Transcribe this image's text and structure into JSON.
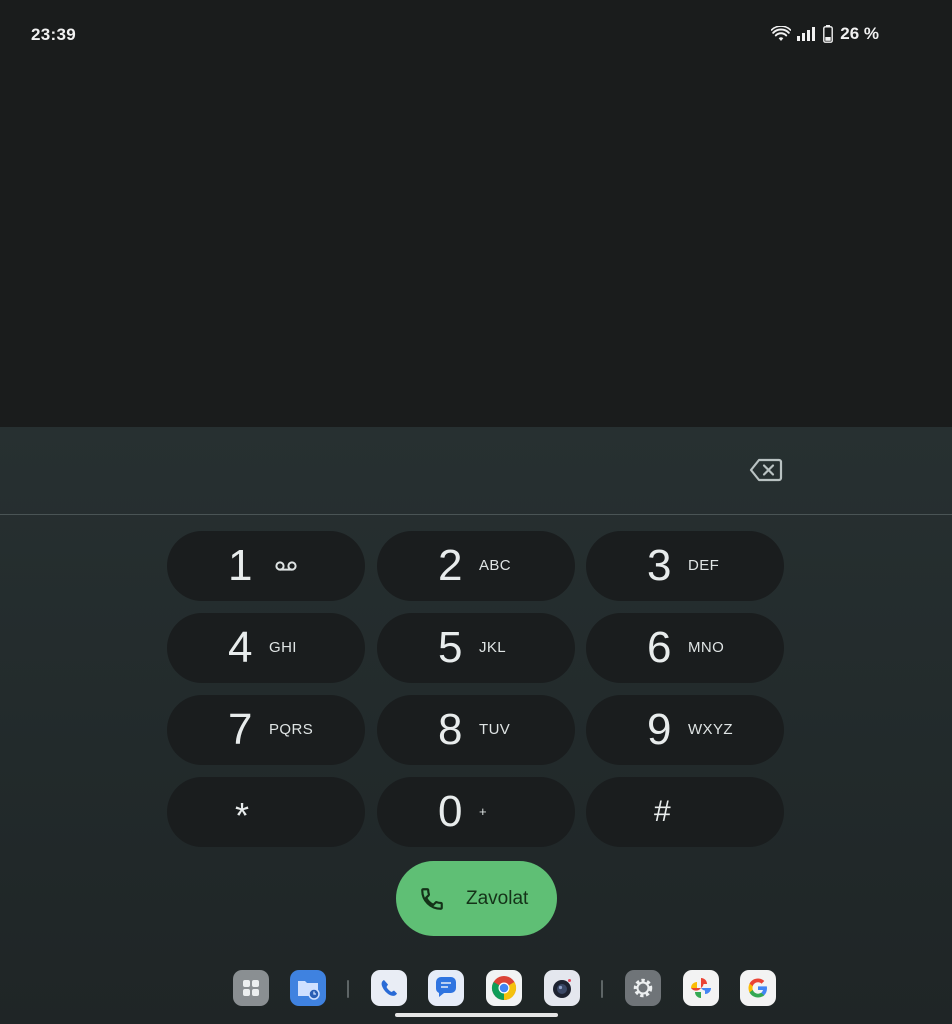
{
  "status_bar": {
    "time": "23:39",
    "battery": "26 %",
    "icons": [
      "wifi-icon",
      "signal-icon",
      "battery-icon"
    ]
  },
  "dialer": {
    "keys": [
      {
        "digit": "1",
        "letters": "",
        "icon": "voicemail-icon"
      },
      {
        "digit": "2",
        "letters": "ABC"
      },
      {
        "digit": "3",
        "letters": "DEF"
      },
      {
        "digit": "4",
        "letters": "GHI"
      },
      {
        "digit": "5",
        "letters": "JKL"
      },
      {
        "digit": "6",
        "letters": "MNO"
      },
      {
        "digit": "7",
        "letters": "PQRS"
      },
      {
        "digit": "8",
        "letters": "TUV"
      },
      {
        "digit": "9",
        "letters": "WXYZ"
      },
      {
        "digit": "*",
        "letters": ""
      },
      {
        "digit": "0",
        "letters": "+"
      },
      {
        "digit": "#",
        "letters": ""
      }
    ],
    "call_label": "Zavolat",
    "call_color": "#5fbf75"
  },
  "taskbar": {
    "apps": [
      "app-drawer-icon",
      "files-icon",
      "phone-icon",
      "messages-icon",
      "chrome-icon",
      "camera-icon",
      "settings-icon",
      "photos-icon",
      "google-icon"
    ]
  }
}
